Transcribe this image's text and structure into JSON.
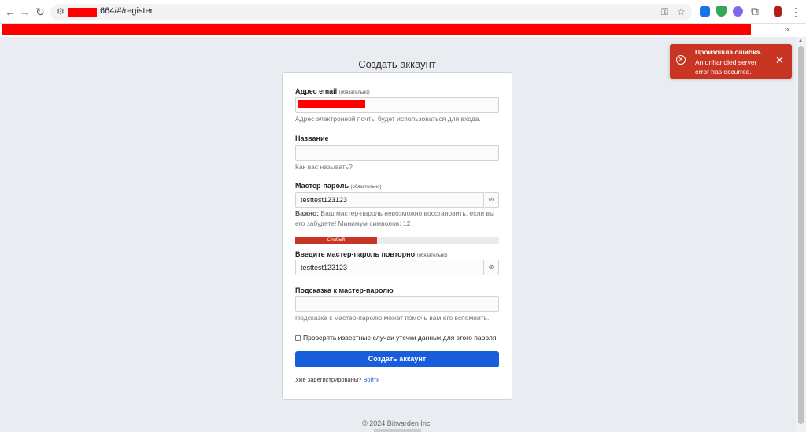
{
  "browser": {
    "url_suffix": ":664/#/register",
    "bookmarks_more": "»"
  },
  "page": {
    "title": "Создать аккаунт",
    "email": {
      "label": "Адрес email",
      "required": "(обязательно)",
      "help": "Адрес электронной почты будет использоваться для входа."
    },
    "name": {
      "label": "Название",
      "value": "",
      "help": "Как вас называть?"
    },
    "master_password": {
      "label": "Мастер-пароль",
      "required": "(обязательно)",
      "value": "testtest123123",
      "help_bold": "Важно:",
      "help": " Ваш мастер-пароль невозможно восстановить, если вы его забудете! Минимум символов: 12"
    },
    "strength": {
      "label": "Слабый",
      "level": 0.4,
      "color": "#c83522"
    },
    "confirm_password": {
      "label": "Введите мастер-пароль повторно",
      "required": "(обязательно)",
      "value": "testtest123123"
    },
    "hint": {
      "label": "Подсказка к мастер-паролю",
      "value": "",
      "help": "Подсказка к мастер-паролю может помочь вам его вспомнить."
    },
    "breach_check_label": "Проверять известные случаи утечки данных для этого пароля",
    "submit_label": "Создать аккаунт",
    "already_registered": "Уже зарегистрированы?",
    "login_link": "Войти",
    "footer": "© 2024 Bitwarden Inc."
  },
  "toast": {
    "title": "Произошла ошибка.",
    "message": "An unhandled server error has occurred.",
    "color": "#c83522"
  },
  "colors": {
    "accent": "#175ddc",
    "background": "#e9ecf1"
  }
}
